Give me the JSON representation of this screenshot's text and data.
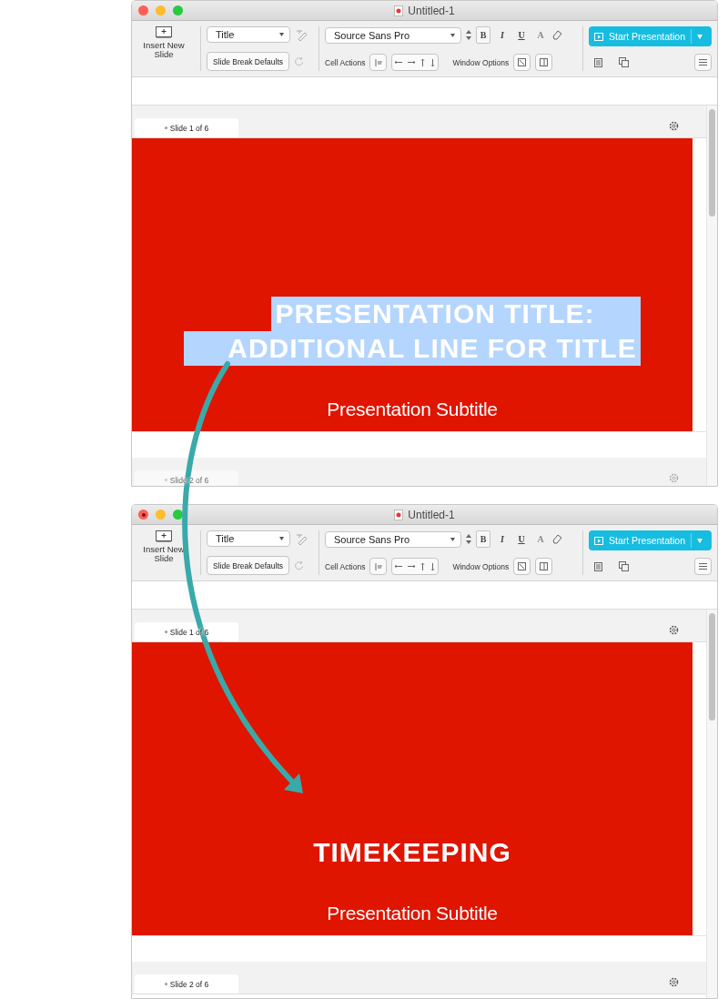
{
  "windows": [
    {
      "title": "Untitled-1",
      "toolbar": {
        "insert_label": "Insert New Slide",
        "style_value": "Title",
        "slide_break_button": "Slide Break Defaults",
        "font_value": "Source Sans Pro",
        "format_buttons": [
          {
            "label": "B",
            "selected": true,
            "disabled": false
          },
          {
            "label": "I",
            "selected": false,
            "disabled": false
          },
          {
            "label": "U",
            "selected": false,
            "disabled": false
          },
          {
            "label": "A",
            "selected": false,
            "disabled": true
          }
        ],
        "cell_actions_label": "Cell Actions",
        "window_options_label": "Window Options",
        "start_button": "Start Presentation"
      },
      "slides": [
        {
          "tab": "Slide 1 of 6",
          "dimmed": false,
          "title_lines": [
            "PRESENTATION TITLE:",
            "ADDITIONAL LINE FOR TITLE"
          ],
          "title_selected": true,
          "subtitle": "Presentation Subtitle"
        },
        {
          "tab": "Slide 2 of 6",
          "dimmed": true
        }
      ]
    },
    {
      "title": "Untitled-1",
      "toolbar": {
        "insert_label": "Insert New Slide",
        "style_value": "Title",
        "slide_break_button": "Slide Break Defaults",
        "font_value": "Source Sans Pro",
        "format_buttons": [
          {
            "label": "B",
            "selected": true,
            "disabled": false
          },
          {
            "label": "I",
            "selected": false,
            "disabled": false
          },
          {
            "label": "U",
            "selected": false,
            "disabled": false
          },
          {
            "label": "A",
            "selected": false,
            "disabled": true
          }
        ],
        "cell_actions_label": "Cell Actions",
        "window_options_label": "Window Options",
        "start_button": "Start Presentation"
      },
      "slides": [
        {
          "tab": "Slide 1 of 6",
          "dimmed": false,
          "title_lines": [
            "TIMEKEEPING"
          ],
          "title_selected": false,
          "subtitle": "Presentation Subtitle"
        },
        {
          "tab": "Slide 2 of 6",
          "dimmed": false
        }
      ]
    }
  ]
}
